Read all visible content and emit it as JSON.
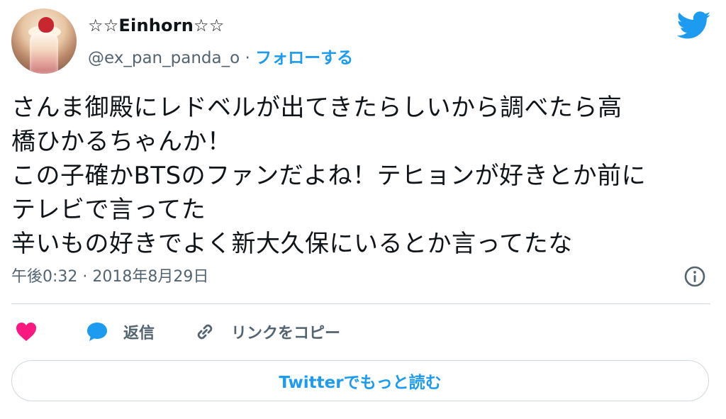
{
  "author": {
    "display_name": "☆☆Einhorn☆☆",
    "handle": "@ex_pan_panda_o",
    "separator": " · ",
    "follow_label": "フォローする"
  },
  "tweet": {
    "text": "さんま御殿にレドベルが出てきたらしいから調べたら高\n橋ひかるちゃんか！\nこの子確かBTSのファンだよね！テヒョンが好きとか前に\nテレビで言ってた\n辛いもの好きでよく新大久保にいるとか言ってたな",
    "timestamp": "午後0:32 · 2018年8月29日"
  },
  "actions": {
    "reply_label": "返信",
    "copy_link_label": "リンクをコピー"
  },
  "read_more_label": "Twitterでもっと読む",
  "icons": {
    "brand": "twitter-bird-icon",
    "info": "info-icon",
    "like": "heart-icon",
    "reply": "speech-bubble-icon",
    "link": "link-icon"
  },
  "colors": {
    "accent": "#1d9bf0",
    "like": "#f91880",
    "secondary_text": "#536471",
    "border": "#cfd9de"
  }
}
